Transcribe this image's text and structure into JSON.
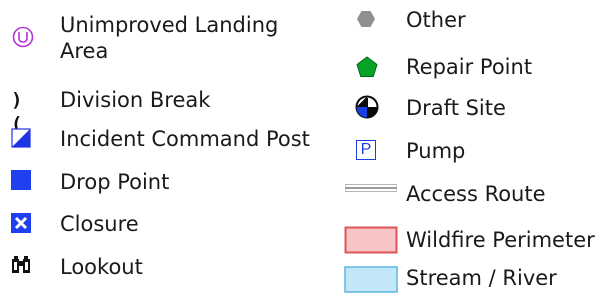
{
  "legend": {
    "left_column": [
      {
        "id": "unimproved-landing-area",
        "icon": "unimproved-landing-area-icon",
        "label_line1": "Unimproved Landing",
        "label_line2": "Area",
        "color": "#b833d6"
      },
      {
        "id": "division-break",
        "icon": "division-break-icon",
        "glyph": ")(",
        "label": "Division Break",
        "color": "#111111"
      },
      {
        "id": "incident-command-post",
        "icon": "incident-command-post-icon",
        "label": "Incident Command Post",
        "color": "#1f33e6"
      },
      {
        "id": "drop-point",
        "icon": "drop-point-icon",
        "label": "Drop Point",
        "color": "#1f3ff0"
      },
      {
        "id": "closure",
        "icon": "closure-icon",
        "label": "Closure",
        "color": "#1f3ff0"
      },
      {
        "id": "lookout",
        "icon": "lookout-icon",
        "label": "Lookout",
        "color": "#111111"
      }
    ],
    "right_column": [
      {
        "id": "other",
        "icon": "hexagon-icon",
        "label": "Other",
        "color": "#8f8f8f"
      },
      {
        "id": "repair-point",
        "icon": "pentagon-icon",
        "label": "Repair Point",
        "color": "#07a326"
      },
      {
        "id": "draft-site",
        "icon": "draft-site-icon",
        "label": "Draft Site",
        "color": "#1a3fe0"
      },
      {
        "id": "pump",
        "icon": "pump-icon",
        "glyph": "P",
        "label": "Pump",
        "color": "#1a3fe0"
      },
      {
        "id": "access-route",
        "icon": "access-route-icon",
        "label": "Access Route",
        "color": "#9c9c9c"
      },
      {
        "id": "wildfire-perimeter",
        "icon": "wildfire-perimeter-icon",
        "label": "Wildfire Perimeter",
        "fill": "#f7c5c5",
        "stroke": "#e05454"
      },
      {
        "id": "stream-river",
        "icon": "stream-river-icon",
        "label": "Stream / River",
        "fill": "#c3e6f8",
        "stroke": "#5cb7e3"
      }
    ]
  }
}
